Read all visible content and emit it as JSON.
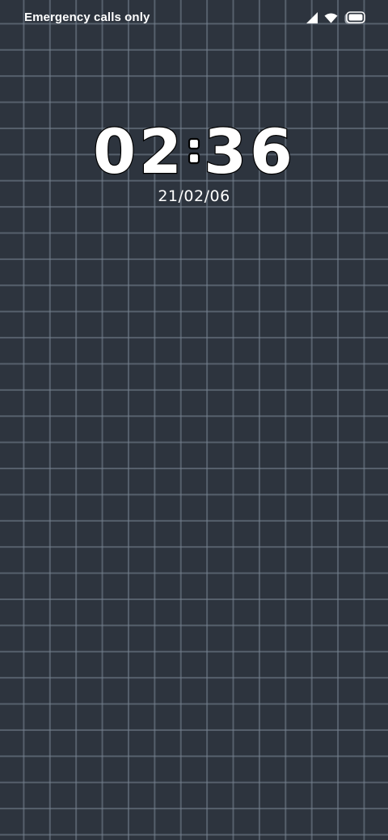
{
  "status_bar": {
    "carrier_text": "Emergency calls only",
    "icons": [
      "signal-icon",
      "wifi-icon",
      "battery-icon"
    ]
  },
  "lockscreen": {
    "time_hours": "02",
    "time_separator": ":",
    "time_minutes": "36",
    "date": "21/02/06"
  },
  "colors": {
    "background": "#2d343e",
    "grid_line": "#6c7785",
    "text": "#ffffff",
    "clock_outline": "#000000"
  }
}
